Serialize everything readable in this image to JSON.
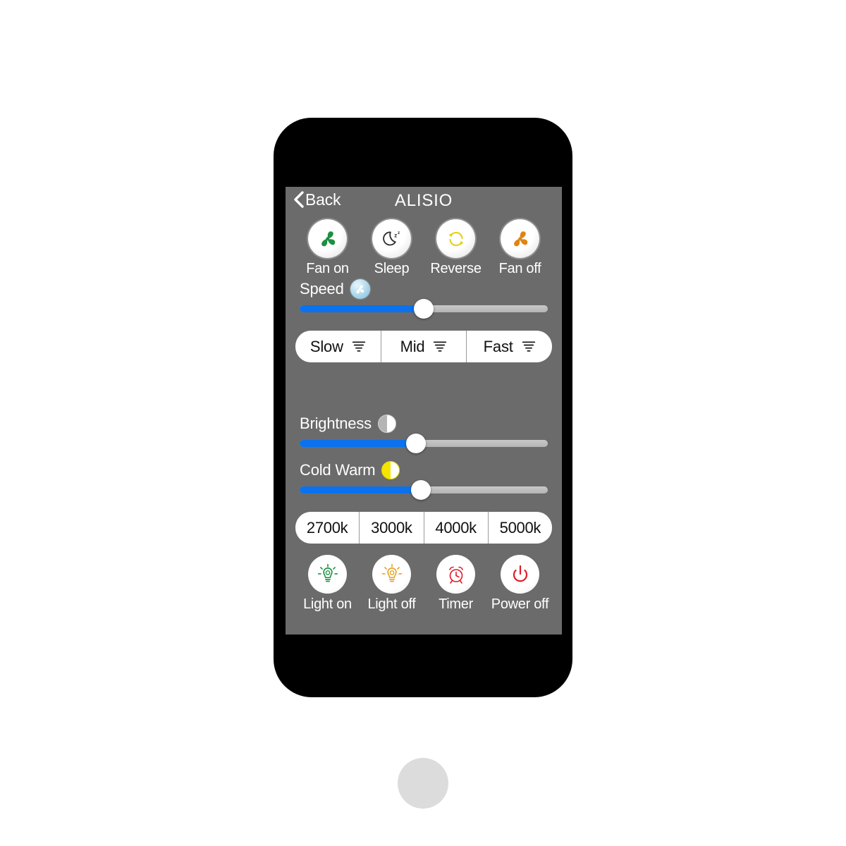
{
  "device": {
    "frame_color": "#000000",
    "screen_bg": "#6b6b6b",
    "home_button": "home-button",
    "camera": "front-camera",
    "earpiece": "earpiece-speaker"
  },
  "nav": {
    "back_label": "Back",
    "title": "ALISIO"
  },
  "fan_controls": [
    {
      "label": "Fan on",
      "icon": "fan-icon",
      "color": "#1a9141"
    },
    {
      "label": "Sleep",
      "icon": "moon-sleep-icon",
      "color": "#2b2b2b"
    },
    {
      "label": "Reverse",
      "icon": "reverse-arrows-icon",
      "color": "#e6d118"
    },
    {
      "label": "Fan off",
      "icon": "fan-icon",
      "color": "#e08412"
    }
  ],
  "speed": {
    "label": "Speed",
    "icon": "fan-badge-icon",
    "value_pct": 50,
    "fill_color": "#0a72ef",
    "track_color": "#b4b4b4"
  },
  "speed_modes": [
    {
      "label": "Slow",
      "icon": "tornado-icon"
    },
    {
      "label": "Mid",
      "icon": "tornado-icon"
    },
    {
      "label": "Fast",
      "icon": "tornado-icon"
    }
  ],
  "brightness": {
    "label": "Brightness",
    "icon": "half-circle-gray-icon",
    "value_pct": 47,
    "fill_color": "#0a72ef"
  },
  "cold_warm": {
    "label": "Cold Warm",
    "icon": "half-circle-yellow-icon",
    "value_pct": 49,
    "fill_color": "#0a72ef",
    "accent": "#f5e400"
  },
  "color_temps": [
    {
      "label": "2700k"
    },
    {
      "label": "3000k"
    },
    {
      "label": "4000k"
    },
    {
      "label": "5000k"
    }
  ],
  "light_controls": [
    {
      "label": "Light on",
      "icon": "bulb-on-icon",
      "color": "#1a9141"
    },
    {
      "label": "Light off",
      "icon": "bulb-off-icon",
      "color": "#e8a020"
    },
    {
      "label": "Timer",
      "icon": "alarm-clock-icon",
      "color": "#e01b24"
    },
    {
      "label": "Power off",
      "icon": "power-icon",
      "color": "#e01b24"
    }
  ]
}
